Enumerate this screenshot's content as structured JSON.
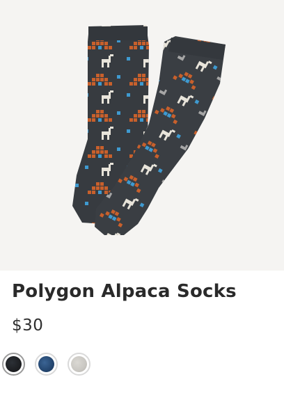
{
  "product": {
    "title": "Polygon Alpaca Socks",
    "price": "$30",
    "image_icon": "alpaca-socks-product-image"
  },
  "swatches": [
    {
      "name": "charcoal-black",
      "color": "#1d1f22",
      "accent": "#3a78b8",
      "selected": true
    },
    {
      "name": "navy-blue",
      "color": "#24466f",
      "accent": "#5f8fc0",
      "selected": false
    },
    {
      "name": "light-grey",
      "color": "#c9c7c2",
      "accent": "#9e9a93",
      "selected": false
    }
  ],
  "colors": {
    "image_background": "#f5f4f2",
    "sock_body": "#373b40",
    "pattern_orange": "#c8602c",
    "pattern_blue": "#3f9ad0",
    "pattern_cream": "#e8e4da",
    "pattern_grey": "#a6a6a6"
  }
}
